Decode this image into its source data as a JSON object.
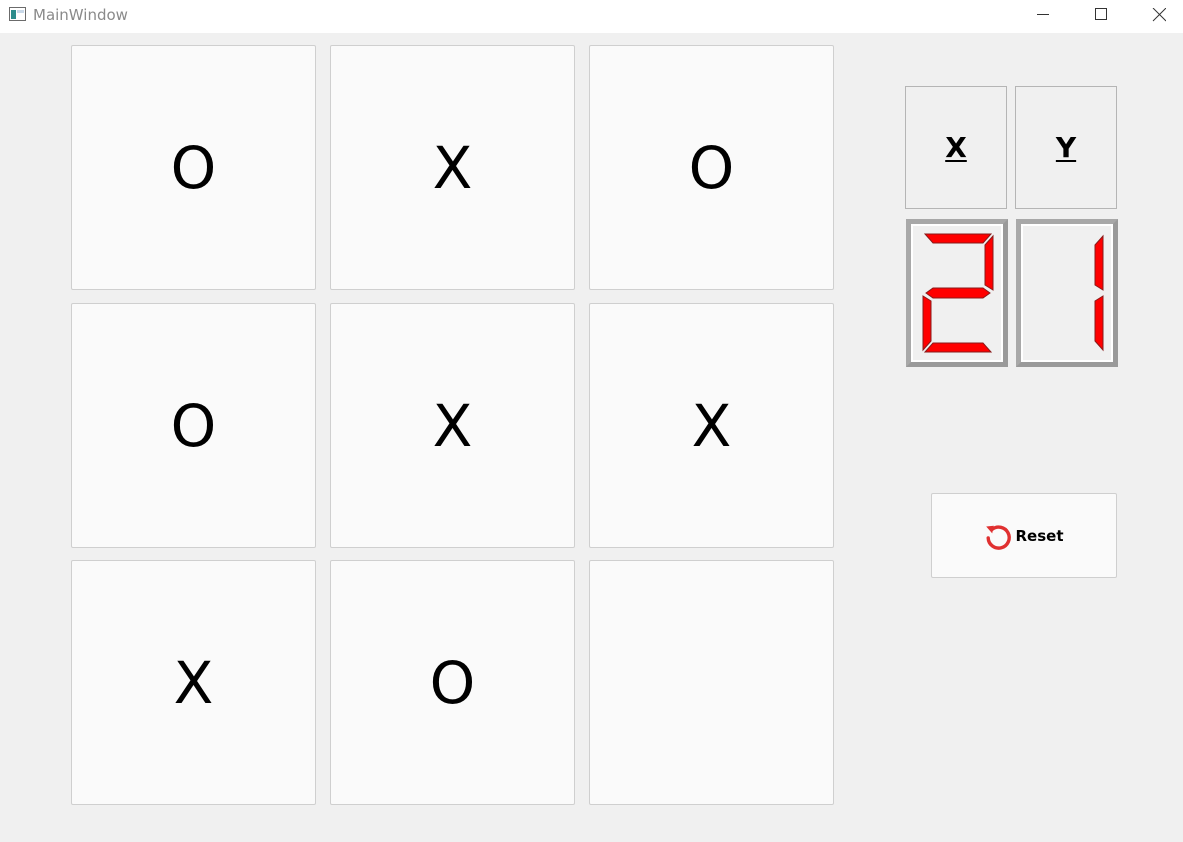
{
  "window": {
    "title": "MainWindow",
    "icon": "app-window-icon"
  },
  "board": {
    "cells": [
      "O",
      "X",
      "O",
      "O",
      "X",
      "X",
      "X",
      "O",
      ""
    ]
  },
  "players": {
    "x_label": "X",
    "y_label": "Y"
  },
  "scores": {
    "x": "2",
    "y": "1",
    "lcd_color": "#ff0000"
  },
  "reset": {
    "label": "Reset",
    "icon": "reset-icon",
    "icon_color": "#e03030"
  }
}
